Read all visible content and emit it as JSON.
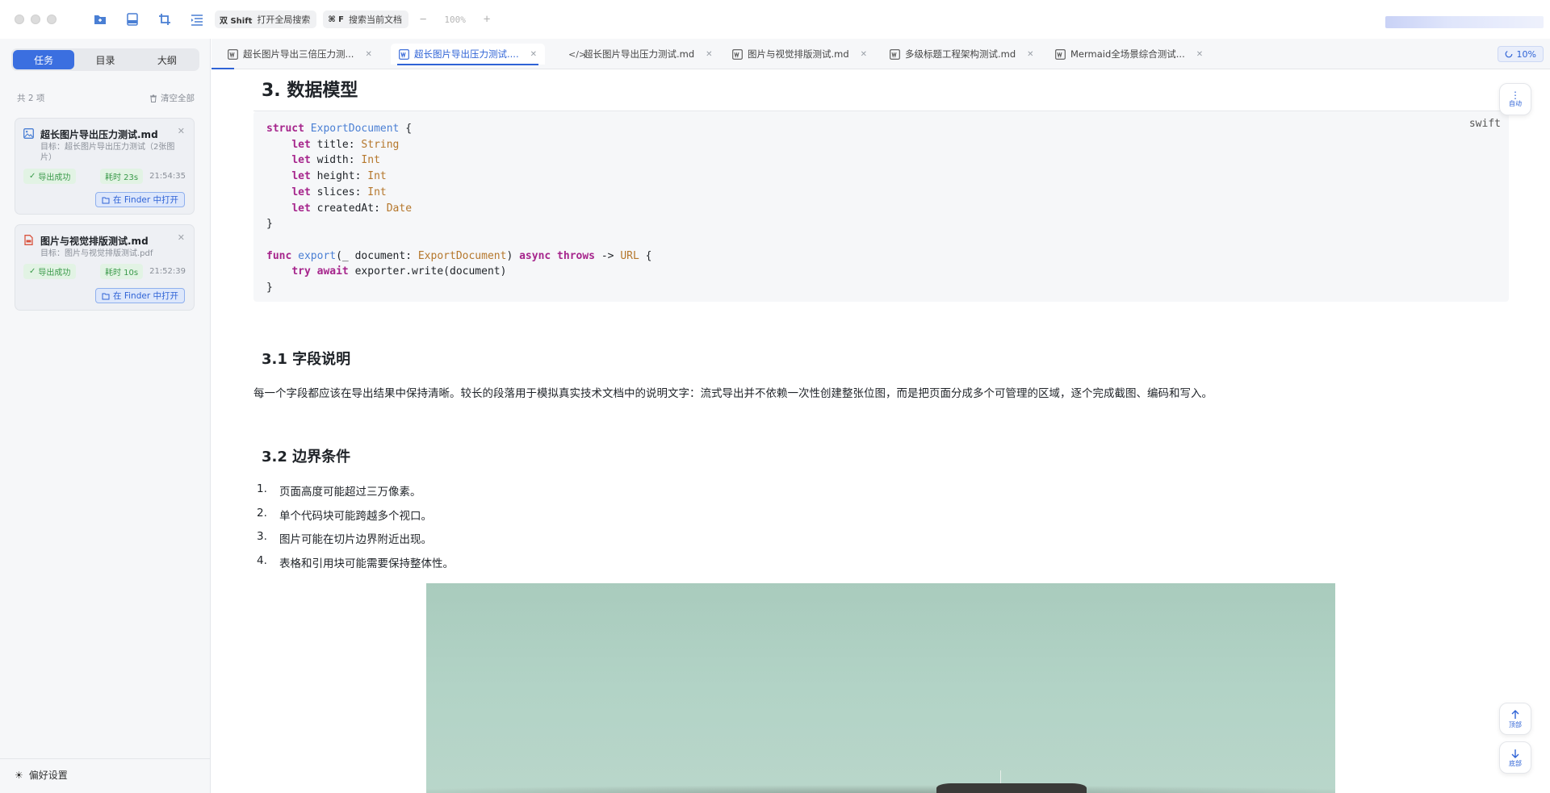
{
  "titlebar": {
    "shortcut_global": {
      "key": "双 Shift",
      "label": "打开全局搜索"
    },
    "shortcut_doc": {
      "key": "⌘ F",
      "label": "搜索当前文档"
    },
    "zoom_minus": "−",
    "zoom_level": "100%",
    "zoom_plus": "+"
  },
  "sidebar": {
    "tabs": [
      {
        "label": "任务"
      },
      {
        "label": "目录"
      },
      {
        "label": "大纲"
      }
    ],
    "count": "共 2 项",
    "clear_all": "清空全部",
    "tasks": [
      {
        "file": "超长图片导出压力测试.md",
        "target": "目标：超长图片导出压力测试（2张图片）",
        "status": "导出成功",
        "duration": "耗时 23s",
        "time": "21:54:35",
        "open_button": "在 Finder 中打开"
      },
      {
        "file": "图片与视觉排版测试.md",
        "target": "目标：图片与视觉排版测试.pdf",
        "status": "导出成功",
        "duration": "耗时 10s",
        "time": "21:52:39",
        "open_button": "在 Finder 中打开"
      }
    ],
    "preferences": "偏好设置"
  },
  "tabs": [
    {
      "label": "超长图片导出三倍压力测..."
    },
    {
      "label": "超长图片导出压力测试...."
    },
    {
      "label": "超长图片导出压力测试.md"
    },
    {
      "label": "图片与视觉排版测试.md"
    },
    {
      "label": "多级标题工程架构测试.md"
    },
    {
      "label": "Mermaid全场景综合测试..."
    }
  ],
  "tab_progress": "10%",
  "content": {
    "h2": "3. 数据模型",
    "code_lang": "swift",
    "h3_fields": "3.1 字段说明",
    "paragraph": "每一个字段都应该在导出结果中保持清晰。较长的段落用于模拟真实技术文档中的说明文字：流式导出并不依赖一次性创建整张位图，而是把页面分成多个可管理的区域，逐个完成截图、编码和写入。",
    "h3_edges": "3.2 边界条件",
    "list": [
      {
        "num": "1.",
        "text": "页面高度可能超过三万像素。"
      },
      {
        "num": "2.",
        "text": "单个代码块可能跨越多个视口。"
      },
      {
        "num": "3.",
        "text": "图片可能在切片边界附近出现。"
      },
      {
        "num": "4.",
        "text": "表格和引用块可能需要保持整体性。"
      }
    ]
  },
  "float": {
    "auto": "自动",
    "top": "顶部",
    "bottom": "底部"
  },
  "colors": {
    "accent": "#3b6fe0",
    "success": "#3a9a4a",
    "keyword": "#a6258c",
    "type": "#b5772c",
    "function": "#4a7fd4"
  }
}
